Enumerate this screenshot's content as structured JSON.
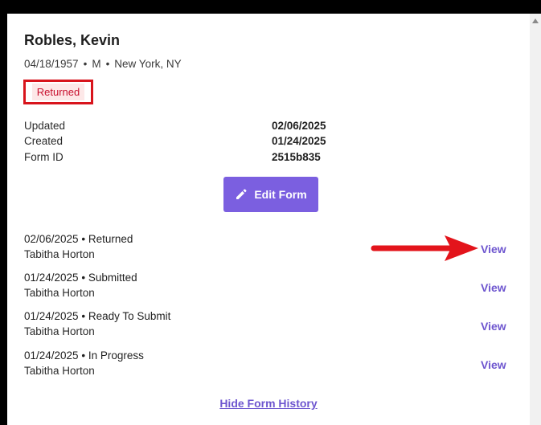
{
  "patient": {
    "name": "Robles, Kevin",
    "dob": "04/18/1957",
    "sex": "M",
    "location": "New York, NY",
    "separator": "•"
  },
  "status": {
    "label": "Returned",
    "highlight_color": "#d8141c",
    "badge_bg": "#fde8e8",
    "badge_text": "#c8102e"
  },
  "meta": {
    "updated_label": "Updated",
    "updated_value": "02/06/2025",
    "created_label": "Created",
    "created_value": "01/24/2025",
    "formid_label": "Form ID",
    "formid_value": "2515b835"
  },
  "edit_button": {
    "label": "Edit Form",
    "icon": "pencil-icon",
    "color": "#7b5fe0"
  },
  "history": [
    {
      "date": "02/06/2025",
      "status": "Returned",
      "user": "Tabitha Horton",
      "action": "View"
    },
    {
      "date": "01/24/2025",
      "status": "Submitted",
      "user": "Tabitha Horton",
      "action": "View"
    },
    {
      "date": "01/24/2025",
      "status": "Ready To Submit",
      "user": "Tabitha Horton",
      "action": "View"
    },
    {
      "date": "01/24/2025",
      "status": "In Progress",
      "user": "Tabitha Horton",
      "action": "View"
    }
  ],
  "history_separator": "•",
  "annotation": {
    "icon": "red-arrow-icon",
    "color": "#e3141b"
  },
  "hide_history_label": "Hide Form History",
  "link_color": "#6e56cf"
}
